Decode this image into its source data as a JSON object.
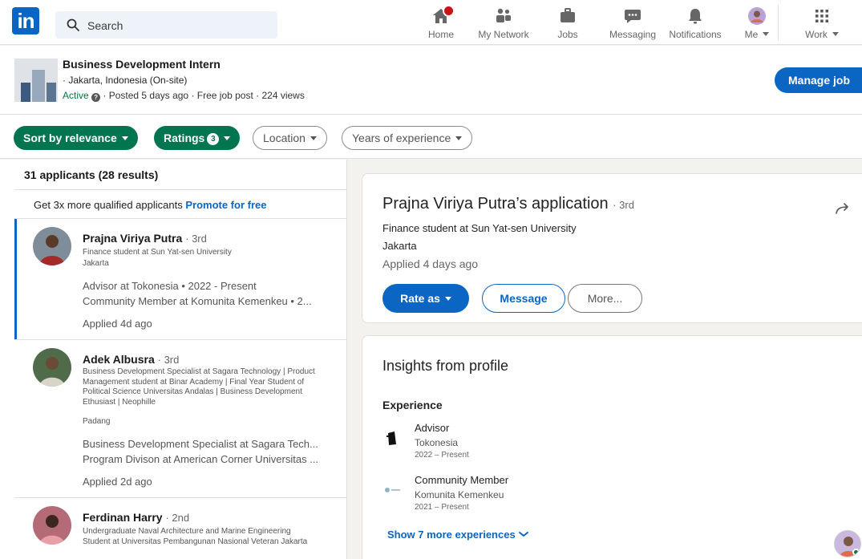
{
  "nav": {
    "logo": "in",
    "search_placeholder": "Search",
    "items": [
      {
        "label": "Home",
        "icon": "home-icon"
      },
      {
        "label": "My Network",
        "icon": "network-icon"
      },
      {
        "label": "Jobs",
        "icon": "briefcase-icon"
      },
      {
        "label": "Messaging",
        "icon": "messaging-icon"
      },
      {
        "label": "Notifications",
        "icon": "bell-icon"
      },
      {
        "label": "Me",
        "icon": "profile-avatar"
      },
      {
        "label": "Work",
        "icon": "grid-icon"
      }
    ]
  },
  "job": {
    "title": "Business Development Intern",
    "location": "· Jakarta, Indonesia (On-site)",
    "status": "Active",
    "meta": "· Posted 5 days ago · Free job post · 224 views",
    "manage_label": "Manage job"
  },
  "filters": {
    "sort": "Sort by relevance",
    "ratings": "Ratings",
    "ratings_count": "3",
    "location": "Location",
    "experience": "Years of experience"
  },
  "list": {
    "count": "31 applicants (28 results)",
    "promote_text": "Get 3x more qualified applicants",
    "promote_link": "Promote for free",
    "applicants": [
      {
        "name": "Prajna Viriya Putra",
        "degree": "· 3rd",
        "headline": "Finance student at Sun Yat-sen University",
        "location": "Jakarta",
        "exp1": "Advisor at Tokonesia • 2022 - Present",
        "exp2": "Community Member at Komunita Kemenkeu • 2...",
        "applied": "Applied 4d ago"
      },
      {
        "name": "Adek Albusra",
        "degree": "· 3rd",
        "headline": "Business Development Specialist at Sagara Technology | Product Management student at Binar Academy | Final Year Student of Political Science Universitas Andalas | Business Development Ethusiast | Neophille",
        "location": "Padang",
        "exp1": "Business Development Specialist at Sagara Tech...",
        "exp2": "Program Divison at American Corner Universitas ...",
        "applied": "Applied 2d ago"
      },
      {
        "name": "Ferdinan Harry",
        "degree": "· 2nd",
        "headline": "Undergraduate Naval Architecture and Marine Engineering Student at Universitas Pembangunan Nasional Veteran Jakarta"
      }
    ]
  },
  "detail": {
    "title": "Prajna Viriya Putra’s application",
    "degree": "· 3rd",
    "headline": "Finance student at Sun Yat-sen University",
    "location": "Jakarta",
    "applied": "Applied 4 days ago",
    "rate_label": "Rate as",
    "message_label": "Message",
    "more_label": "More...",
    "insights_title": "Insights from profile",
    "experience_heading": "Experience",
    "experiences": [
      {
        "title": "Advisor",
        "company": "Tokonesia",
        "dates": "2022 – Present"
      },
      {
        "title": "Community Member",
        "company": "Komunita Kemenkeu",
        "dates": "2021 – Present"
      }
    ],
    "show_more": "Show 7 more experiences"
  },
  "colors": {
    "brand": "#0a66c2",
    "green": "#01754f",
    "active": "#057642"
  }
}
